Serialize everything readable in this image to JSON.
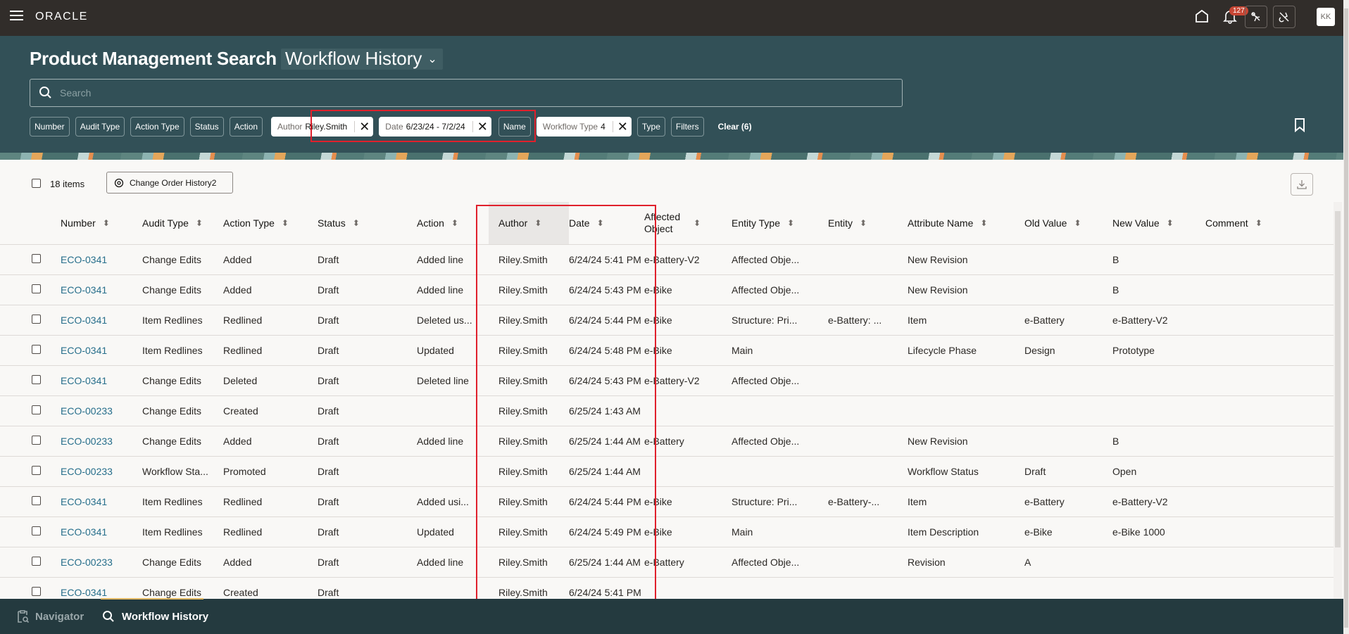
{
  "app": {
    "brand": "ORACLE",
    "notifications_count": "127",
    "user_initials": "KK"
  },
  "header": {
    "title": "Product Management Search",
    "view_select": "Workflow History",
    "search_placeholder": "Search",
    "search_value": ""
  },
  "filters": [
    {
      "label": "Number",
      "active": false
    },
    {
      "label": "Audit Type",
      "active": false
    },
    {
      "label": "Action Type",
      "active": false
    },
    {
      "label": "Status",
      "active": false
    },
    {
      "label": "Action",
      "active": false
    },
    {
      "label": "Author",
      "value": "Riley.Smith",
      "active": true
    },
    {
      "label": "Date",
      "value": "6/23/24 - 7/2/24",
      "active": true
    },
    {
      "label": "Name",
      "active": false
    },
    {
      "label": "Workflow Type",
      "value": "4",
      "active": true
    },
    {
      "label": "Type",
      "active": false
    },
    {
      "label": "Filters",
      "active": false
    }
  ],
  "clear_label": "Clear (6)",
  "toolbar": {
    "item_count": "18 items",
    "saved_view_label": "Change Order History2"
  },
  "table": {
    "columns": [
      "Number",
      "Audit Type",
      "Action Type",
      "Status",
      "Action",
      "Author",
      "Date",
      "Affected Object",
      "Entity Type",
      "Entity",
      "Attribute Name",
      "Old Value",
      "New Value",
      "Comment"
    ],
    "rows": [
      [
        "ECO-0341",
        "Change Edits",
        "Added",
        "Draft",
        "Added line",
        "Riley.Smith",
        "6/24/24 5:41 PM",
        "e-Battery-V2",
        "Affected Obje...",
        "",
        "New Revision",
        "",
        "B",
        ""
      ],
      [
        "ECO-0341",
        "Change Edits",
        "Added",
        "Draft",
        "Added line",
        "Riley.Smith",
        "6/24/24 5:43 PM",
        "e-Bike",
        "Affected Obje...",
        "",
        "New Revision",
        "",
        "B",
        ""
      ],
      [
        "ECO-0341",
        "Item Redlines",
        "Redlined",
        "Draft",
        "Deleted us...",
        "Riley.Smith",
        "6/24/24 5:44 PM",
        "e-Bike",
        "Structure: Pri...",
        "e-Battery: ...",
        "Item",
        "e-Battery",
        "e-Battery-V2",
        ""
      ],
      [
        "ECO-0341",
        "Item Redlines",
        "Redlined",
        "Draft",
        "Updated",
        "Riley.Smith",
        "6/24/24 5:48 PM",
        "e-Bike",
        "Main",
        "",
        "Lifecycle Phase",
        "Design",
        "Prototype",
        ""
      ],
      [
        "ECO-0341",
        "Change Edits",
        "Deleted",
        "Draft",
        "Deleted line",
        "Riley.Smith",
        "6/24/24 5:43 PM",
        "e-Battery-V2",
        "Affected Obje...",
        "",
        "",
        "",
        "",
        ""
      ],
      [
        "ECO-00233",
        "Change Edits",
        "Created",
        "Draft",
        "",
        "Riley.Smith",
        "6/25/24 1:43 AM",
        "",
        "",
        "",
        "",
        "",
        "",
        ""
      ],
      [
        "ECO-00233",
        "Change Edits",
        "Added",
        "Draft",
        "Added line",
        "Riley.Smith",
        "6/25/24 1:44 AM",
        "e-Battery",
        "Affected Obje...",
        "",
        "New Revision",
        "",
        "B",
        ""
      ],
      [
        "ECO-00233",
        "Workflow Sta...",
        "Promoted",
        "Draft",
        "",
        "Riley.Smith",
        "6/25/24 1:44 AM",
        "",
        "",
        "",
        "Workflow Status",
        "Draft",
        "Open",
        ""
      ],
      [
        "ECO-0341",
        "Item Redlines",
        "Redlined",
        "Draft",
        "Added usi...",
        "Riley.Smith",
        "6/24/24 5:44 PM",
        "e-Bike",
        "Structure: Pri...",
        "e-Battery-...",
        "Item",
        "e-Battery",
        "e-Battery-V2",
        ""
      ],
      [
        "ECO-0341",
        "Item Redlines",
        "Redlined",
        "Draft",
        "Updated",
        "Riley.Smith",
        "6/24/24 5:49 PM",
        "e-Bike",
        "Main",
        "",
        "Item Description",
        "e-Bike",
        "e-Bike 1000",
        ""
      ],
      [
        "ECO-00233",
        "Change Edits",
        "Added",
        "Draft",
        "Added line",
        "Riley.Smith",
        "6/25/24 1:44 AM",
        "e-Battery",
        "Affected Obje...",
        "",
        "Revision",
        "A",
        "",
        ""
      ],
      [
        "ECO-0341",
        "Change Edits",
        "Created",
        "Draft",
        "",
        "Riley.Smith",
        "6/24/24 5:41 PM",
        "",
        "",
        "",
        "",
        "",
        "",
        ""
      ]
    ]
  },
  "footer": {
    "tabs": [
      {
        "label": "Navigator",
        "active": false
      },
      {
        "label": "Workflow History",
        "active": true
      }
    ]
  },
  "colors": {
    "topbar": "#312d2a",
    "header": "#325057",
    "footer": "#243a3f",
    "link": "#266e8b",
    "highlight": "#e0202c",
    "badge": "#c74634",
    "active_tab_underline": "#e3b964"
  }
}
